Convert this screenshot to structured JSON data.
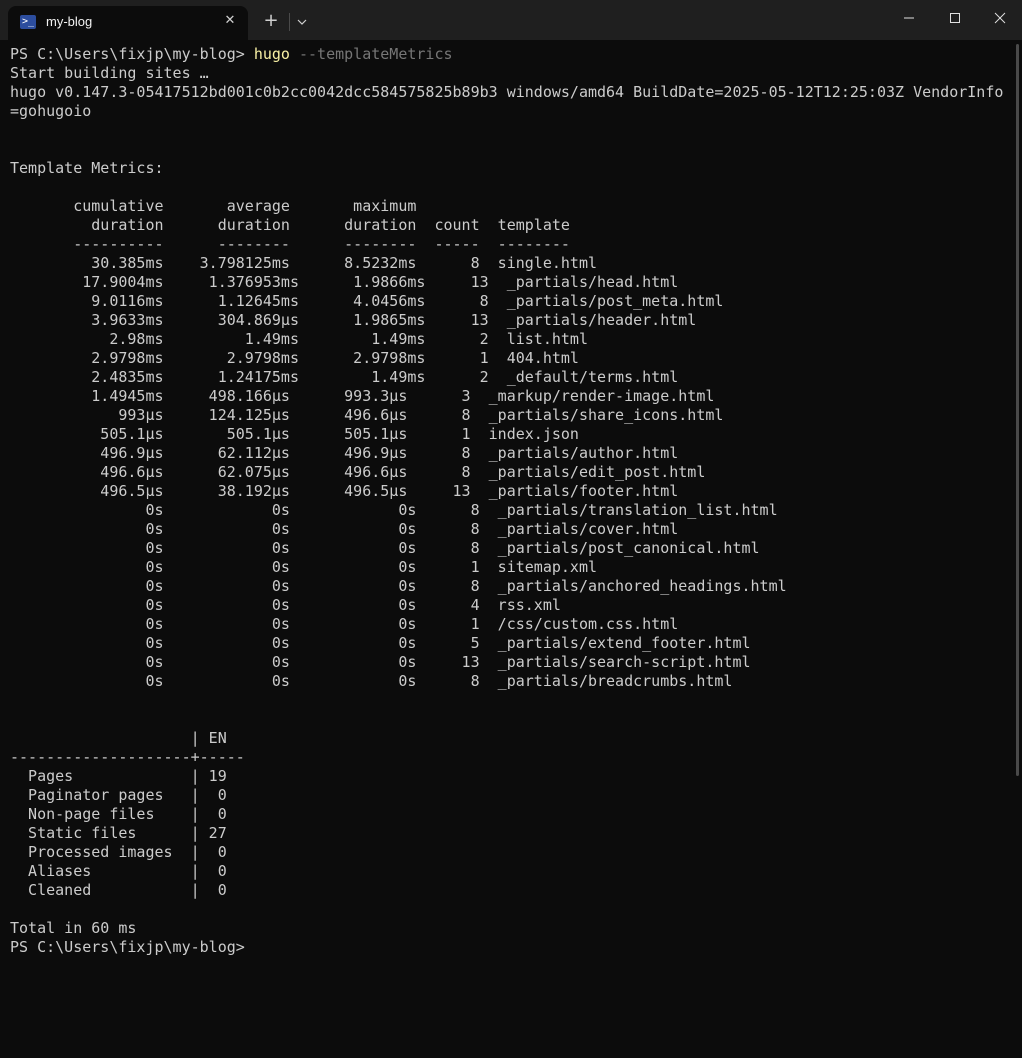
{
  "tab": {
    "title": "my-blog",
    "icon": "powershell-icon"
  },
  "window_controls": [
    "minimize-icon",
    "maximize-icon",
    "close-icon"
  ],
  "terminal": {
    "prompt": "PS C:\\Users\\fixjp\\my-blog> ",
    "command": "hugo",
    "param": " --templateMetrics",
    "body": "Start building sites …\nhugo v0.147.3-05417512bd001c0b2cc0042dcc584575825b89b3 windows/amd64 BuildDate=2025-05-12T12:25:03Z VendorInfo\n=gohugoio\n\n\nTemplate Metrics:\n\n       cumulative       average       maximum\n         duration      duration      duration  count  template\n       ----------      --------      --------  -----  --------\n         30.385ms    3.798125ms      8.5232ms      8  single.html\n        17.9004ms     1.376953ms      1.9866ms     13  _partials/head.html\n         9.0116ms      1.12645ms      4.0456ms      8  _partials/post_meta.html\n         3.9633ms      304.869µs      1.9865ms     13  _partials/header.html\n           2.98ms         1.49ms        1.49ms      2  list.html\n         2.9798ms       2.9798ms      2.9798ms      1  404.html\n         2.4835ms      1.24175ms        1.49ms      2  _default/terms.html\n         1.4945ms     498.166µs      993.3µs      3  _markup/render-image.html\n            993µs     124.125µs      496.6µs      8  _partials/share_icons.html\n          505.1µs       505.1µs      505.1µs      1  index.json\n          496.9µs      62.112µs      496.9µs      8  _partials/author.html\n          496.6µs      62.075µs      496.6µs      8  _partials/edit_post.html\n          496.5µs      38.192µs      496.5µs     13  _partials/footer.html\n               0s            0s            0s      8  _partials/translation_list.html\n               0s            0s            0s      8  _partials/cover.html\n               0s            0s            0s      8  _partials/post_canonical.html\n               0s            0s            0s      1  sitemap.xml\n               0s            0s            0s      8  _partials/anchored_headings.html\n               0s            0s            0s      4  rss.xml\n               0s            0s            0s      1  /css/custom.css.html\n               0s            0s            0s      5  _partials/extend_footer.html\n               0s            0s            0s     13  _partials/search-script.html\n               0s            0s            0s      8  _partials/breadcrumbs.html\n\n\n                    | EN\n--------------------+-----\n  Pages             | 19\n  Paginator pages   |  0\n  Non-page files    |  0\n  Static files      | 27\n  Processed images  |  0\n  Aliases           |  0\n  Cleaned           |  0\n\nTotal in 60 ms",
    "final_prompt": "PS C:\\Users\\fixjp\\my-blog>"
  }
}
